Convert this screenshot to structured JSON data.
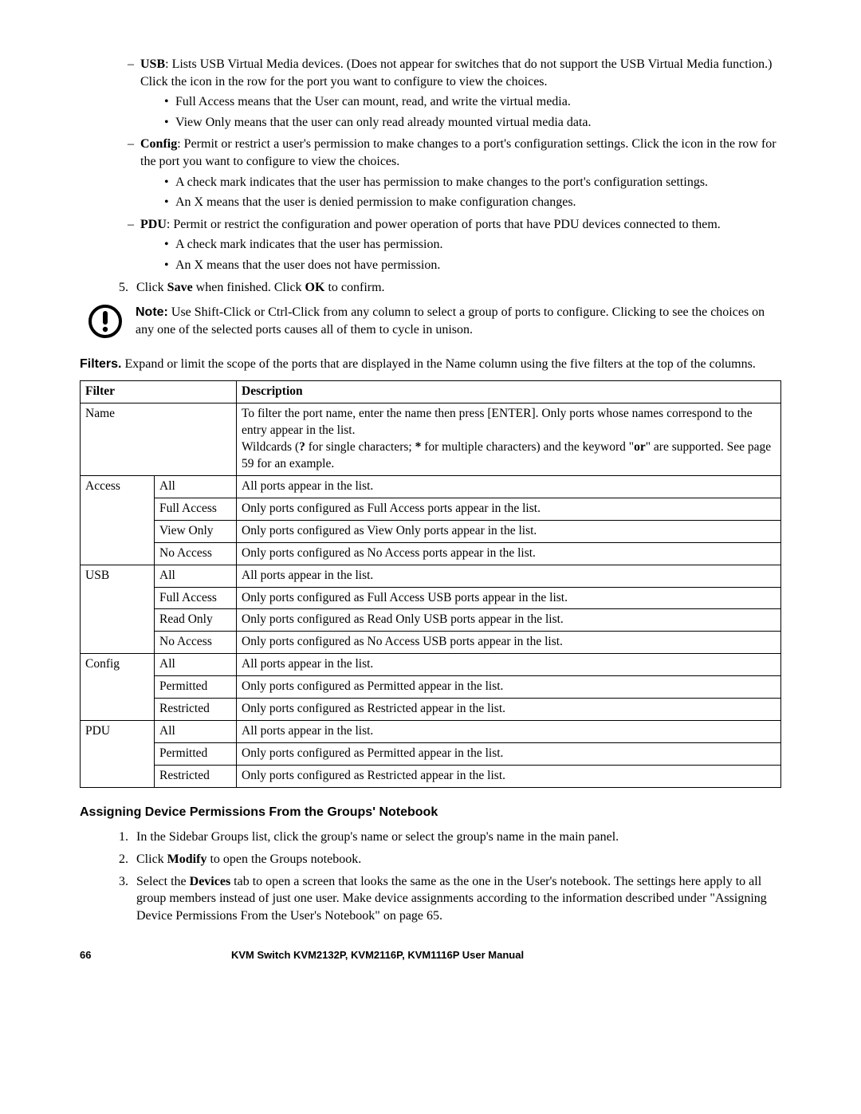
{
  "list1": {
    "usb_label": "USB",
    "usb_text": ": Lists USB Virtual Media devices. (Does not appear for switches that do not support the USB Virtual Media function.) Click the icon in the row for the port you want to configure to view the choices.",
    "usb_b1": "Full Access means that the User can mount, read, and write the virtual media.",
    "usb_b2": "View Only means that the user can only read already mounted virtual media data.",
    "config_label": "Config",
    "config_text": ": Permit or restrict a user's permission to make changes to a port's configuration settings. Click the icon in the row for the port you want to configure to view the choices.",
    "config_b1": "A check mark indicates that the user has permission to make changes to the port's configuration settings.",
    "config_b2": "An X means that the user is denied permission to make configuration changes.",
    "pdu_label": "PDU",
    "pdu_text": ": Permit or restrict the configuration and power operation of ports that have PDU devices connected to them.",
    "pdu_b1": "A check mark indicates that the user has permission.",
    "pdu_b2": "An X means that the user does not have permission."
  },
  "step5_pre": "Click ",
  "step5_save": "Save",
  "step5_mid": " when finished. Click ",
  "step5_ok": "OK",
  "step5_post": " to confirm.",
  "note_label": "Note:",
  "note_text": " Use Shift-Click or Ctrl-Click from any column to select a group of ports to configure. Clicking to see the choices on any one of the selected ports causes all of them to cycle in unison.",
  "filters_label": "Filters.",
  "filters_text": " Expand or limit the scope of the ports that are displayed in the Name column using the five filters at the top of the columns.",
  "table": {
    "h1": "Filter",
    "h2": "Description",
    "name": "Name",
    "name_d1": "To filter the port name, enter the name then press [ENTER]. Only ports whose names correspond to the entry appear in the list.",
    "name_d2a": "Wildcards (",
    "name_q": "?",
    "name_d2b": " for single characters; ",
    "name_star": "*",
    "name_d2c": " for multiple characters) and the keyword \"",
    "name_or": "or",
    "name_d2d": "\" are supported. See page 59 for an example.",
    "access": "Access",
    "all": "All",
    "all_d": "All ports appear in the list.",
    "fa": "Full Access",
    "access_fa_d": "Only ports configured as Full Access ports appear in the list.",
    "vo": "View Only",
    "access_vo_d": "Only ports configured as View Only ports appear in the list.",
    "na": "No Access",
    "access_na_d": "Only ports configured as No Access ports appear in the list.",
    "usb": "USB",
    "usb_fa_d": "Only ports configured as Full Access USB ports appear in the list.",
    "ro": "Read Only",
    "usb_ro_d": "Only ports configured as Read Only USB ports appear in the list.",
    "usb_na_d": "Only ports configured as No Access USB ports appear in the list.",
    "config": "Config",
    "perm": "Permitted",
    "config_perm_d": "Only ports configured as Permitted appear in the list.",
    "rest": "Restricted",
    "config_rest_d": "Only ports configured as Restricted appear in the list.",
    "pdu": "PDU",
    "pdu_perm_d": "Only ports configured as Permitted appear in the list.",
    "pdu_rest_d": "Only ports configured as Restricted appear in the list."
  },
  "h3": "Assigning Device Permissions From the Groups' Notebook",
  "ol": {
    "i1": "In the Sidebar Groups list, click the group's name or select the group's name in the main panel.",
    "i2a": "Click ",
    "i2b": "Modify",
    "i2c": " to open the Groups notebook.",
    "i3a": "Select the ",
    "i3b": "Devices",
    "i3c": " tab to open a screen that looks the same as the one in the User's notebook. The settings here apply to all group members instead of just one user. Make device assignments according to the information described under \"Assigning Device Permissions From the User's Notebook\" on page 65."
  },
  "footer": {
    "page": "66",
    "title": "KVM Switch KVM2132P, KVM2116P, KVM1116P User Manual"
  }
}
